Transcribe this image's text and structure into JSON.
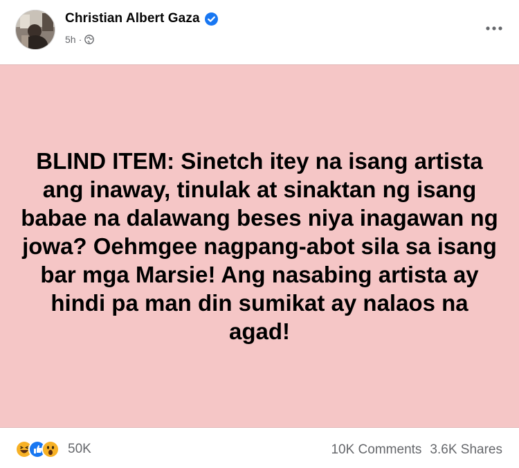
{
  "post": {
    "author": "Christian Albert Gaza",
    "time": "5h",
    "separator": "·",
    "text": "BLIND ITEM: Sinetch itey na isang artista ang inaway, tinulak at sinaktan ng isang babae na dalawang beses niya inagawan ng jowa? Oehmgee nagpang-abot sila sa isang bar mga Marsie! Ang nasabing artista ay hindi pa man din sumikat ay nalaos na agad!",
    "background_color": "#f5c6c6"
  },
  "icons": {
    "verified": "verified-badge-icon",
    "audience": "globe-icon",
    "more": "more-options-icon",
    "reactions": [
      "haha-reaction-icon",
      "like-reaction-icon",
      "wow-reaction-icon"
    ]
  },
  "footer": {
    "reaction_count": "50K",
    "comments": "10K Comments",
    "shares": "3.6K Shares"
  },
  "colors": {
    "verified_blue": "#1877f2",
    "secondary_text": "#65676b"
  }
}
